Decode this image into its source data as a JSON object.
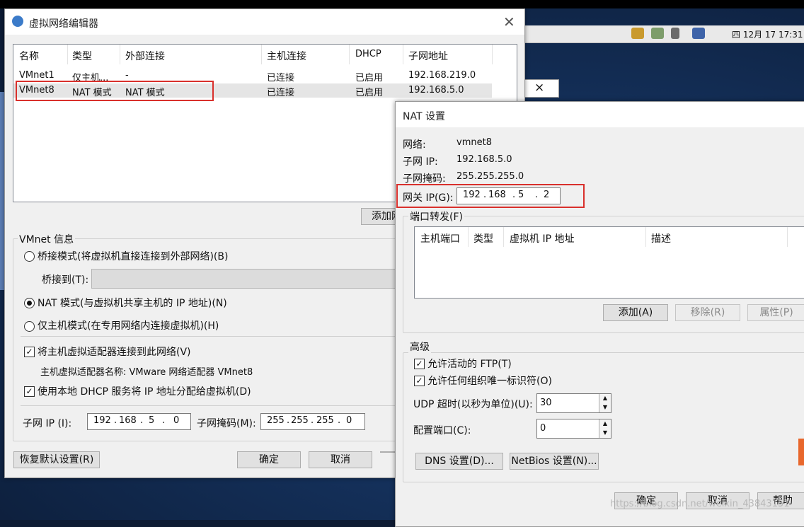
{
  "taskbar": {
    "clock": "四 12月 17 17:31"
  },
  "editor": {
    "title": "虚拟网络编辑器",
    "columns": [
      "名称",
      "类型",
      "外部连接",
      "主机连接",
      "DHCP",
      "子网地址"
    ],
    "rows": [
      {
        "name": "VMnet1",
        "type": "仅主机...",
        "external": "-",
        "host": "已连接",
        "dhcp": "已启用",
        "subnet": "192.168.219.0"
      },
      {
        "name": "VMnet8",
        "type": "NAT 模式",
        "external": "NAT 模式",
        "host": "已连接",
        "dhcp": "已启用",
        "subnet": "192.168.5.0"
      }
    ],
    "add_network_button": "添加网",
    "vmnet_info_label": "VMnet 信息",
    "bridge_mode": "桥接模式(将虚拟机直接连接到外部网络)(B)",
    "bridge_to_label": "桥接到(T):",
    "nat_mode": "NAT 模式(与虚拟机共享主机的 IP 地址)(N)",
    "host_only_mode": "仅主机模式(在专用网络内连接虚拟机)(H)",
    "connect_adapter": "将主机虚拟适配器连接到此网络(V)",
    "adapter_name": "主机虚拟适配器名称: VMware 网络适配器 VMnet8",
    "use_dhcp": "使用本地 DHCP 服务将 IP 地址分配给虚拟机(D)",
    "subnet_ip_label": "子网 IP (I):",
    "subnet_ip": [
      "192",
      "168",
      "5",
      "0"
    ],
    "subnet_mask_label": "子网掩码(M):",
    "subnet_mask": [
      "255",
      "255",
      "255",
      "0"
    ],
    "restore_button": "恢复默认设置(R)",
    "ok_button": "确定",
    "cancel_button": "取消"
  },
  "nat": {
    "title": "NAT 设置",
    "network_label": "网络:",
    "network_value": "vmnet8",
    "subnet_ip_label": "子网 IP:",
    "subnet_ip_value": "192.168.5.0",
    "subnet_mask_label": "子网掩码:",
    "subnet_mask_value": "255.255.255.0",
    "gateway_label": "网关 IP(G):",
    "gateway_ip": [
      "192",
      "168",
      "5",
      "2"
    ],
    "port_forward_label": "端口转发(F)",
    "pf_columns": [
      "主机端口",
      "类型",
      "虚拟机 IP 地址",
      "描述"
    ],
    "add_button": "添加(A)",
    "remove_button": "移除(R)",
    "properties_button": "属性(P)",
    "advanced_label": "高级",
    "allow_ftp": "允许活动的 FTP(T)",
    "allow_oui": "允许任何组织唯一标识符(O)",
    "udp_timeout_label": "UDP 超时(以秒为单位)(U):",
    "udp_timeout_value": "30",
    "config_port_label": "配置端口(C):",
    "config_port_value": "0",
    "dns_button": "DNS 设置(D)...",
    "netbios_button": "NetBios 设置(N)...",
    "ok_button": "确定",
    "cancel_button": "取消",
    "help_button": "帮助"
  },
  "behind_window_close": "×",
  "watermark": "https://blog.csdn.net/weixin_43843151"
}
